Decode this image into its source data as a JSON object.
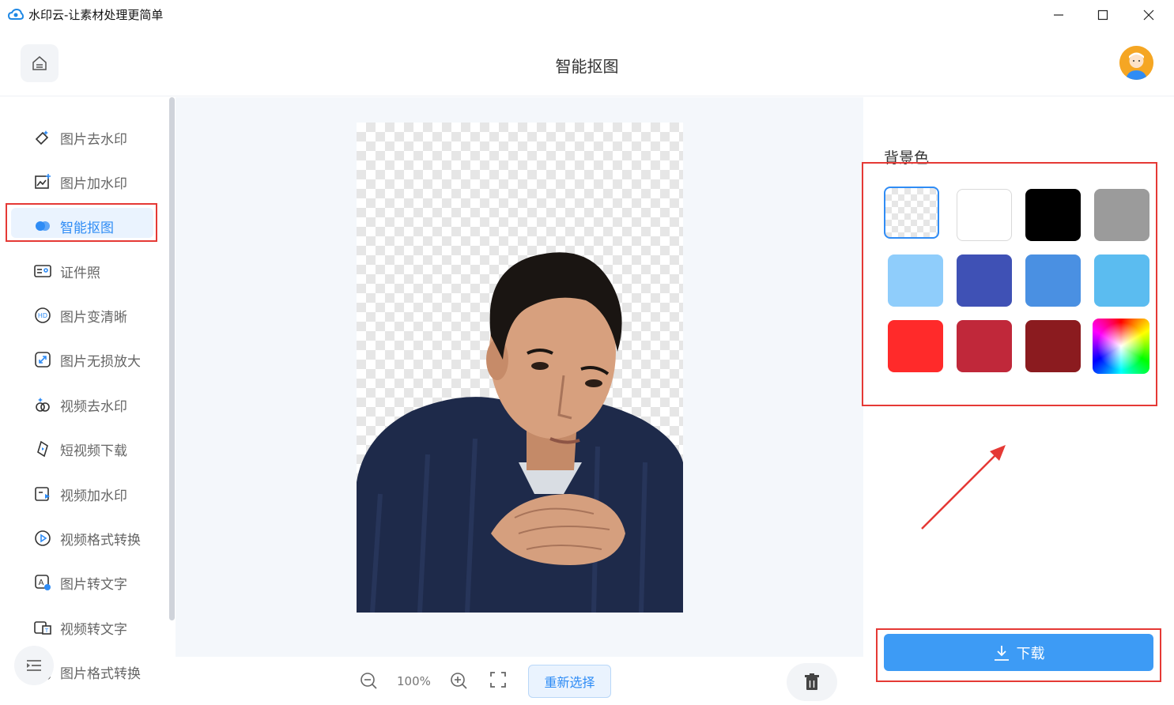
{
  "window": {
    "title": "水印云-让素材处理更简单"
  },
  "header": {
    "title": "智能抠图"
  },
  "sidebar": {
    "items": [
      {
        "label": "图片去水印",
        "icon": "eraser-icon"
      },
      {
        "label": "图片加水印",
        "icon": "image-add-icon"
      },
      {
        "label": "智能抠图",
        "icon": "cutout-icon",
        "active": true
      },
      {
        "label": "证件照",
        "icon": "id-card-icon"
      },
      {
        "label": "图片变清晰",
        "icon": "hd-icon"
      },
      {
        "label": "图片无损放大",
        "icon": "enlarge-icon"
      },
      {
        "label": "视频去水印",
        "icon": "video-clean-icon"
      },
      {
        "label": "短视频下载",
        "icon": "short-video-icon"
      },
      {
        "label": "视频加水印",
        "icon": "video-add-icon"
      },
      {
        "label": "视频格式转换",
        "icon": "video-convert-icon"
      },
      {
        "label": "图片转文字",
        "icon": "image-text-icon"
      },
      {
        "label": "视频转文字",
        "icon": "video-text-icon"
      },
      {
        "label": "图片格式转换",
        "icon": "image-convert-icon"
      }
    ]
  },
  "toolbar": {
    "zoom": "100%",
    "reselect_label": "重新选择"
  },
  "panel": {
    "bg_label": "背景色",
    "swatches": [
      {
        "name": "transparent",
        "color": "transparent"
      },
      {
        "name": "white",
        "color": "#ffffff"
      },
      {
        "name": "black",
        "color": "#000000"
      },
      {
        "name": "gray",
        "color": "#9b9b9b"
      },
      {
        "name": "light-blue",
        "color": "#8fcdfb"
      },
      {
        "name": "royal-blue",
        "color": "#3f51b5"
      },
      {
        "name": "medium-blue",
        "color": "#4a90e2"
      },
      {
        "name": "sky-blue",
        "color": "#5bbcf0"
      },
      {
        "name": "red",
        "color": "#ff2a2a"
      },
      {
        "name": "crimson",
        "color": "#c0283a"
      },
      {
        "name": "dark-red",
        "color": "#8b1b1f"
      },
      {
        "name": "custom-gradient",
        "color": "gradient"
      }
    ],
    "download_label": "下载"
  },
  "colors": {
    "accent": "#2f8cf5",
    "highlight": "#e53935"
  }
}
